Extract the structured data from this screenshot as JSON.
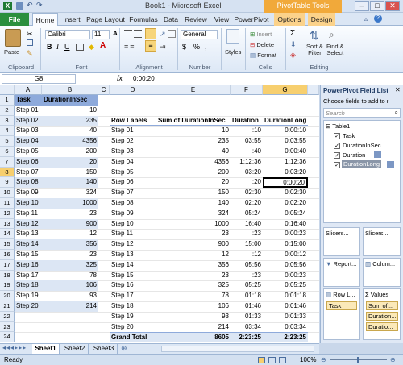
{
  "titlebar": {
    "title": "Book1 - Microsoft Excel",
    "context_tab": "PivotTable Tools"
  },
  "tabs": [
    "File",
    "Home",
    "Insert",
    "Page Layout",
    "Formulas",
    "Data",
    "Review",
    "View",
    "PowerPivot",
    "Options",
    "Design"
  ],
  "ribbon": {
    "paste": "Paste",
    "font_name": "Calibri",
    "font_size": "11",
    "number_format": "General",
    "styles": "Styles",
    "insert": "Insert",
    "delete": "Delete",
    "format": "Format",
    "sort": "Sort &\nFilter",
    "find": "Find &\nSelect",
    "groups": [
      "Clipboard",
      "Font",
      "Alignment",
      "Number",
      "Cells",
      "Editing"
    ],
    "dollar": "$",
    "pct": "%",
    "comma": ","
  },
  "formula_bar": {
    "name_box": "G8",
    "fx": "fx",
    "value": "0:00:20"
  },
  "grid": {
    "col_headers": [
      "A",
      "B",
      "C",
      "D",
      "E",
      "F",
      "G"
    ],
    "table_headers": [
      "Task",
      "DurationInSec"
    ],
    "tasks": [
      "Step 01",
      "Step 02",
      "Step 03",
      "Step 04",
      "Step 05",
      "Step 06",
      "Step 07",
      "Step 08",
      "Step 09",
      "Step 10",
      "Step 11",
      "Step 12",
      "Step 13",
      "Step 14",
      "Step 15",
      "Step 16",
      "Step 17",
      "Step 18",
      "Step 19",
      "Step 20"
    ],
    "secs": [
      "10",
      "235",
      "40",
      "4356",
      "200",
      "20",
      "150",
      "140",
      "324",
      "1000",
      "23",
      "900",
      "12",
      "356",
      "23",
      "325",
      "78",
      "106",
      "93",
      "214"
    ],
    "pivot_headers": [
      "Row Labels",
      "Sum of DurationInSec",
      "Duration",
      "DurationLong"
    ],
    "pivot_sum": [
      "10",
      "235",
      "40",
      "4356",
      "200",
      "20",
      "150",
      "140",
      "324",
      "1000",
      "23",
      "900",
      "12",
      "356",
      "23",
      "325",
      "78",
      "106",
      "93",
      "214"
    ],
    "pivot_dur": [
      ":10",
      "03:55",
      ":40",
      "1:12:36",
      "03:20",
      ":20",
      "02:30",
      "02:20",
      "05:24",
      "16:40",
      ":23",
      "15:00",
      ":12",
      "05:56",
      ":23",
      "05:25",
      "01:18",
      "01:46",
      "01:33",
      "03:34"
    ],
    "pivot_long": [
      "0:00:10",
      "0:03:55",
      "0:00:40",
      "1:12:36",
      "0:03:20",
      "0:00:20",
      "0:02:30",
      "0:02:20",
      "0:05:24",
      "0:16:40",
      "0:00:23",
      "0:15:00",
      "0:00:12",
      "0:05:56",
      "0:00:23",
      "0:05:25",
      "0:01:18",
      "0:01:46",
      "0:01:33",
      "0:03:34"
    ],
    "grand_total": {
      "label": "Grand Total",
      "sum": "8605",
      "dur": "2:23:25",
      "long": "2:23:25"
    }
  },
  "panel": {
    "title": "PowerPivot Field List",
    "subtitle": "Choose fields to add to r",
    "search_placeholder": "Search",
    "table": "Table1",
    "fields": [
      "Task",
      "DurationInSec",
      "Duration",
      "DurationLong"
    ],
    "slicers_v": "Slicers...",
    "slicers_h": "Slicers...",
    "report": "Report...",
    "columns": "Colum...",
    "rows": "Row L...",
    "values": "Values",
    "row_chip": "Task",
    "value_chips": [
      "Sum of...",
      "Duration...",
      "Duratio..."
    ]
  },
  "sheets": [
    "Sheet1",
    "Sheet2",
    "Sheet3"
  ],
  "status": {
    "ready": "Ready",
    "zoom": "100%"
  }
}
